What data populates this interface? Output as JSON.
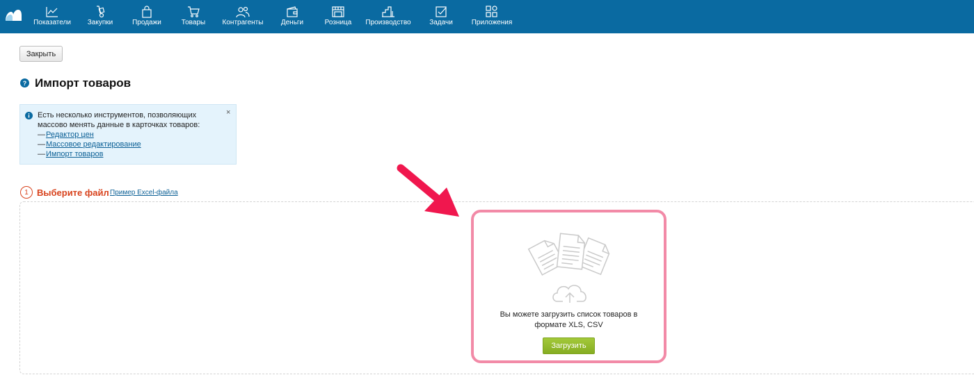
{
  "nav": {
    "items": [
      {
        "label": "Показатели",
        "icon": "chart-line-icon"
      },
      {
        "label": "Закупки",
        "icon": "hand-truck-icon"
      },
      {
        "label": "Продажи",
        "icon": "shopping-bag-icon"
      },
      {
        "label": "Товары",
        "icon": "shopping-cart-icon"
      },
      {
        "label": "Контрагенты",
        "icon": "people-icon"
      },
      {
        "label": "Деньги",
        "icon": "wallet-icon"
      },
      {
        "label": "Розница",
        "icon": "storefront-icon"
      },
      {
        "label": "Производство",
        "icon": "factory-icon"
      },
      {
        "label": "Задачи",
        "icon": "checkbox-icon"
      },
      {
        "label": "Приложения",
        "icon": "apps-grid-icon"
      }
    ]
  },
  "toolbar": {
    "close_label": "Закрыть"
  },
  "page": {
    "title": "Импорт товаров"
  },
  "info_box": {
    "text": "Есть несколько инструментов, позволяющих массово менять данные в карточках товаров:",
    "close_glyph": "×",
    "links": [
      {
        "dash": "—",
        "label": "Редактор цен"
      },
      {
        "dash": "—",
        "label": "Массовое редактирование"
      },
      {
        "dash": "—",
        "label": "Импорт товаров"
      }
    ]
  },
  "step": {
    "number": "1",
    "label": "Выберите файл",
    "example_link": "Пример Excel-файла"
  },
  "upload": {
    "text_line1": "Вы можете загрузить список товаров в",
    "text_line2": "формате XLS, CSV",
    "button_label": "Загрузить"
  },
  "colors": {
    "topbar": "#0a6aa1",
    "step_accent": "#d8421c",
    "highlight_border": "#f28aa7",
    "arrow": "#f0174e",
    "upload_button": "#94ba2e",
    "info_background": "#e4f3fc"
  }
}
